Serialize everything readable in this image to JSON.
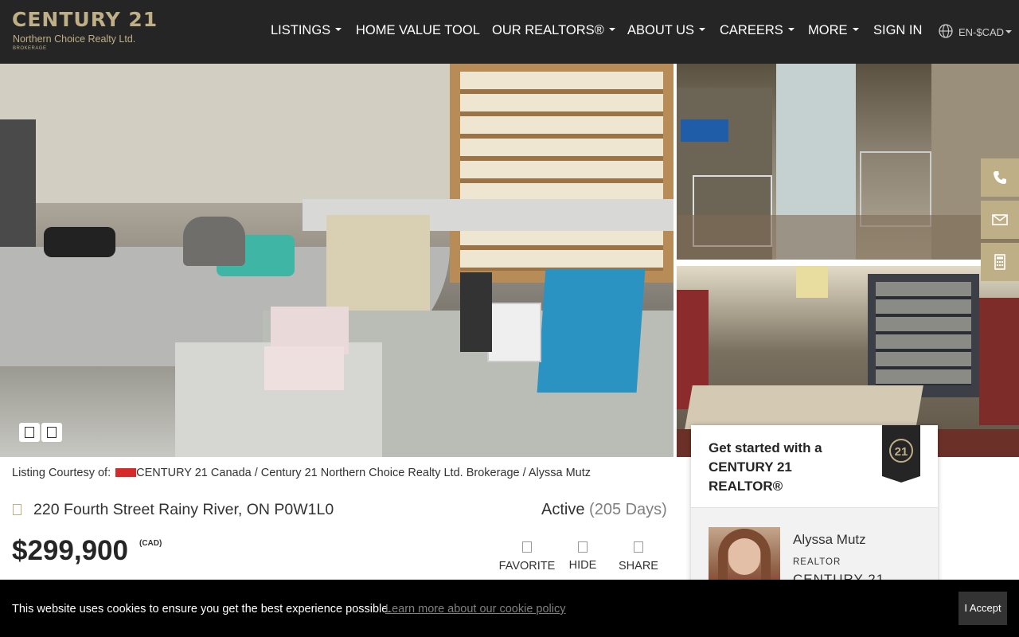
{
  "brand": {
    "name": "CENTURY 21",
    "office": "Northern Choice Realty Ltd.",
    "tag": "BROKERAGE",
    "accent": "#beaf87",
    "dark": "#252526"
  },
  "nav": {
    "items": [
      {
        "label": "LISTINGS",
        "dropdown": true
      },
      {
        "label": "HOME VALUE TOOL",
        "dropdown": false
      },
      {
        "label": "OUR REALTORS®",
        "dropdown": true
      },
      {
        "label": "ABOUT US",
        "dropdown": true
      },
      {
        "label": "CAREERS",
        "dropdown": true
      },
      {
        "label": "MORE",
        "dropdown": true
      },
      {
        "label": "SIGN IN",
        "dropdown": false
      }
    ],
    "language": "EN-$CAD",
    "language_icon": "globe-icon"
  },
  "floating_actions": [
    "phone-icon",
    "email-icon",
    "calculator-icon"
  ],
  "listing": {
    "courtesy_label": "Listing Courtesy of:",
    "courtesy_text": "CENTURY 21 Canada / Century 21 Northern Choice Realty Ltd. Brokerage / Alyssa Mutz",
    "address": "220 Fourth Street Rainy River, ON P0W1L0",
    "status": "Active",
    "days": "(205 Days)",
    "price": "$299,900",
    "currency": "(CAD)",
    "actions": {
      "favorite": "FAVORITE",
      "hide": "HIDE",
      "share": "SHARE"
    }
  },
  "agent_card": {
    "heading": "Get started with a CENTURY 21 REALTOR®",
    "name": "Alyssa Mutz",
    "role": "REALTOR",
    "company": "CENTURY 21"
  },
  "cookie": {
    "message": "This website uses cookies to ensure you get the best experience possible.",
    "link": "Learn more about our cookie policy",
    "accept": "I Accept"
  }
}
